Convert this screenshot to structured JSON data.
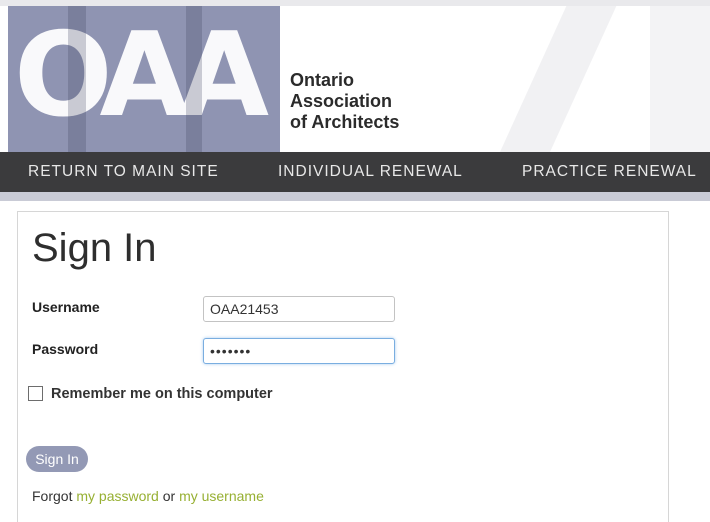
{
  "brand": {
    "logo_text": "OAA",
    "org_name_lines": [
      "Ontario",
      "Association",
      "of Architects"
    ],
    "logo_color": "#8f94b2"
  },
  "nav": {
    "items": [
      {
        "label": "RETURN TO MAIN SITE"
      },
      {
        "label": "INDIVIDUAL RENEWAL"
      },
      {
        "label": "PRACTICE RENEWAL"
      }
    ],
    "background": "#3b3b3d"
  },
  "form": {
    "title": "Sign In",
    "username_label": "Username",
    "username_value": "OAA21453",
    "password_label": "Password",
    "password_value": "•••••••",
    "remember_label": "Remember me on this computer",
    "remember_checked": false,
    "signin_label": "Sign In",
    "forgot_prefix": "Forgot",
    "forgot_password_link": "my password",
    "forgot_or": "or",
    "forgot_username_link": "my username"
  },
  "colors": {
    "button": "#9399b5",
    "link": "#97b033",
    "focus_border": "#7aaee0"
  }
}
